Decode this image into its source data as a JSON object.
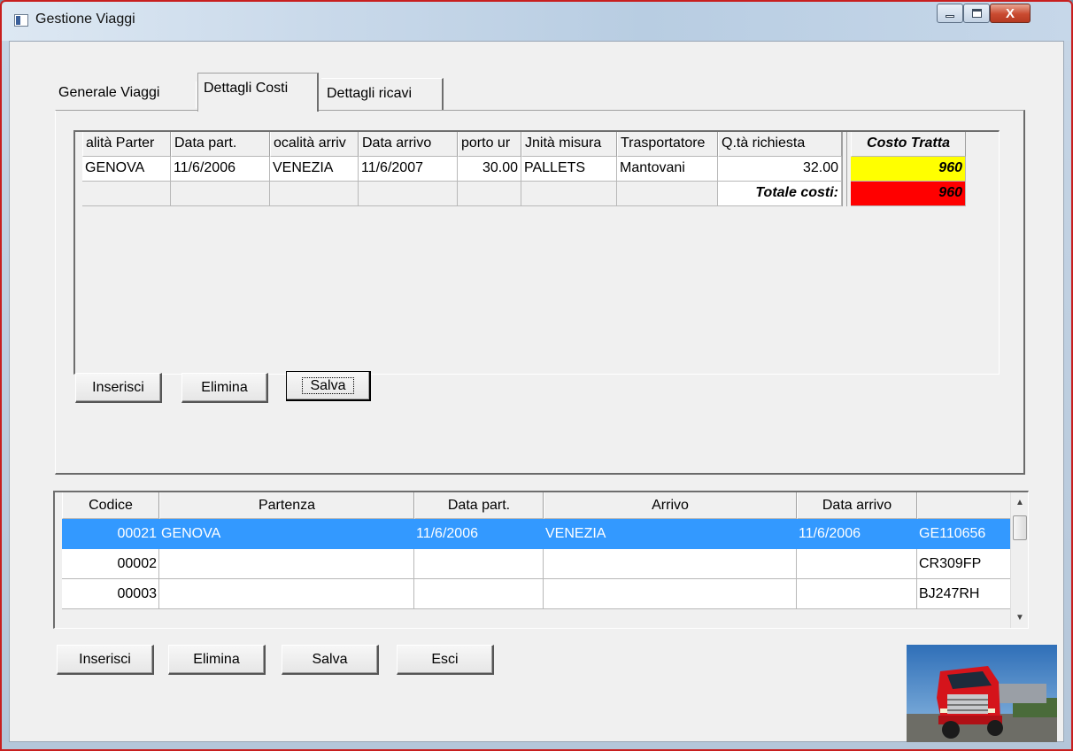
{
  "window": {
    "title": "Gestione Viaggi",
    "close_glyph": "X"
  },
  "tabs": [
    {
      "label": "Generale Viaggi",
      "active": false
    },
    {
      "label": "Dettagli Costi",
      "active": true
    },
    {
      "label": "Dettagli ricavi",
      "active": false
    }
  ],
  "costs_grid": {
    "headers": [
      "alità Parter",
      "Data part.",
      "ocalità arriv",
      "Data arrivo",
      "porto ur",
      "Jnità misura",
      "Trasportatore",
      "Q.tà richiesta",
      "Costo Tratta"
    ],
    "row": [
      "GENOVA",
      "11/6/2006",
      "VENEZIA",
      "11/6/2007",
      "30.00",
      "PALLETS",
      "Mantovani",
      "32.00",
      "960"
    ],
    "total_label": "Totale costi:",
    "total_value": "960",
    "highlight_colors": {
      "costo": "#ffff00",
      "totale": "#ff0000"
    }
  },
  "panel_buttons": {
    "insert": "Inserisci",
    "delete": "Elimina",
    "save": "Salva"
  },
  "trips_grid": {
    "headers": [
      "Codice",
      "Partenza",
      "Data part.",
      "Arrivo",
      "Data arrivo",
      ""
    ],
    "rows": [
      {
        "codice": "00021",
        "partenza": "GENOVA",
        "data_part": "11/6/2006",
        "arrivo": "VENEZIA",
        "data_arrivo": "11/6/2006",
        "targa": "GE110656",
        "selected": true
      },
      {
        "codice": "00002",
        "partenza": "",
        "data_part": "",
        "arrivo": "",
        "data_arrivo": "",
        "targa": "CR309FP",
        "selected": false
      },
      {
        "codice": "00003",
        "partenza": "",
        "data_part": "",
        "arrivo": "",
        "data_arrivo": "",
        "targa": "BJ247RH",
        "selected": false
      }
    ],
    "selection_color": "#3399ff"
  },
  "bottom_buttons": {
    "insert": "Inserisci",
    "delete": "Elimina",
    "save": "Salva",
    "exit": "Esci"
  },
  "icons": [
    "app-icon",
    "minimize-icon",
    "maximize-icon",
    "close-icon",
    "scroll-up-icon",
    "scroll-down-icon"
  ]
}
